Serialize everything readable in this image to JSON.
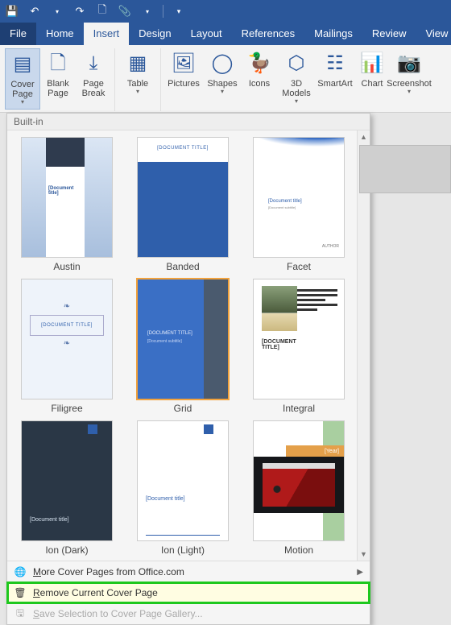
{
  "qat": {
    "save": "save",
    "undo": "undo",
    "redo": "redo",
    "newdoc": "new",
    "paste": "paste",
    "dd": "qat-dd"
  },
  "tabs": {
    "file": "File",
    "home": "Home",
    "insert": "Insert",
    "design": "Design",
    "layout": "Layout",
    "references": "References",
    "mailings": "Mailings",
    "review": "Review",
    "view": "View"
  },
  "ribbon": {
    "cover": "Cover Page",
    "blank": "Blank Page",
    "break": "Page Break",
    "table": "Table",
    "pictures": "Pictures",
    "shapes": "Shapes",
    "icons": "Icons",
    "models": "3D Models",
    "smartart": "SmartArt",
    "chart": "Chart",
    "screenshot": "Screenshot"
  },
  "gallery": {
    "section": "Built-in",
    "items": [
      {
        "label": "Austin",
        "doc": "[Document title]"
      },
      {
        "label": "Banded",
        "doc": "[DOCUMENT TITLE]"
      },
      {
        "label": "Facet",
        "doc": "[Document title]",
        "sub": "[Document subtitle]",
        "r": "AUTHOR"
      },
      {
        "label": "Filigree",
        "doc": "[DOCUMENT TITLE]"
      },
      {
        "label": "Grid",
        "doc": "[DOCUMENT TITLE]",
        "sub": "[Document subtitle]"
      },
      {
        "label": "Integral",
        "doc": "[DOCUMENT TITLE]"
      },
      {
        "label": "Ion (Dark)",
        "doc": "[Document title]"
      },
      {
        "label": "Ion (Light)",
        "doc": "[Document title]"
      },
      {
        "label": "Motion",
        "year": "[Year]"
      }
    ]
  },
  "menu": {
    "more": "More Cover Pages from Office.com",
    "remove": "Remove Current Cover Page",
    "save": "Save Selection to Cover Page Gallery...",
    "more_u": "M",
    "remove_u": "R",
    "save_u": "S"
  }
}
